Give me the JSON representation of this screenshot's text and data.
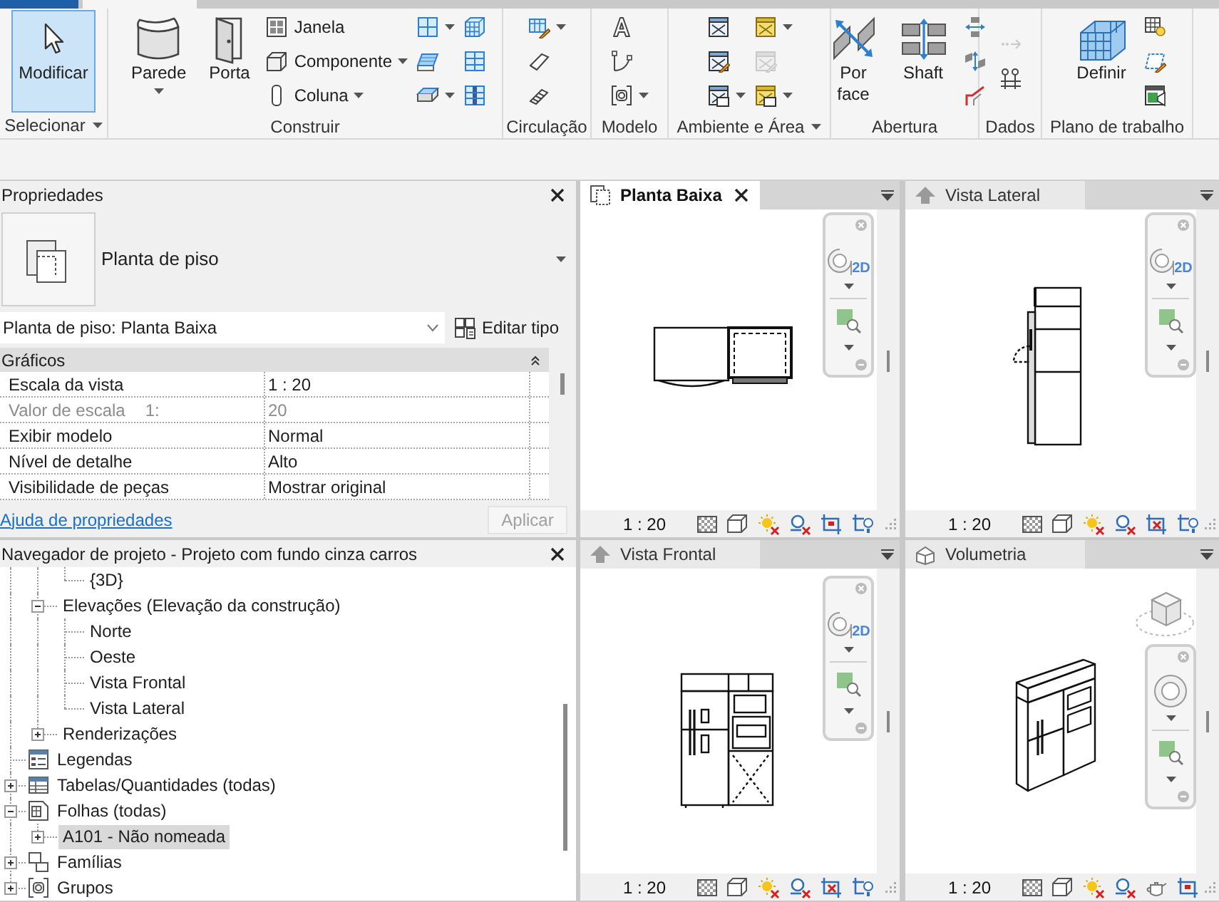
{
  "ribbon": {
    "panels": [
      {
        "title": "Selecionar",
        "menu": true,
        "tools": [
          {
            "kind": "large",
            "label": "Modificar",
            "selected": true,
            "dropdown": false,
            "disabled": false
          }
        ]
      },
      {
        "title": "Construir",
        "menu": false,
        "tools": [
          {
            "kind": "large",
            "label": "Parede",
            "selected": false,
            "dropdown": true,
            "disabled": false
          },
          {
            "kind": "large",
            "label": "Porta",
            "selected": false,
            "dropdown": false,
            "disabled": false
          },
          {
            "kind": "small",
            "label": "Janela",
            "dropdown": false,
            "disabled": false
          },
          {
            "kind": "small",
            "label": "Componente",
            "dropdown": true,
            "disabled": false
          },
          {
            "kind": "small",
            "label": "Coluna",
            "dropdown": true,
            "disabled": false
          },
          {
            "kind": "icon",
            "dropdown": true,
            "disabled": false
          },
          {
            "kind": "icon",
            "dropdown": false,
            "disabled": false
          },
          {
            "kind": "icon",
            "dropdown": true,
            "disabled": false
          },
          {
            "kind": "icon",
            "dropdown": false,
            "disabled": false
          },
          {
            "kind": "icon",
            "dropdown": false,
            "disabled": false
          },
          {
            "kind": "icon",
            "dropdown": false,
            "disabled": false
          }
        ]
      },
      {
        "title": "Circulação",
        "menu": false,
        "tools": [
          {
            "kind": "icon",
            "dropdown": true,
            "disabled": false
          },
          {
            "kind": "icon",
            "dropdown": false,
            "disabled": false
          },
          {
            "kind": "icon",
            "dropdown": false,
            "disabled": false
          }
        ]
      },
      {
        "title": "Modelo",
        "menu": false,
        "tools": [
          {
            "kind": "icon",
            "dropdown": false,
            "disabled": false
          },
          {
            "kind": "icon",
            "dropdown": false,
            "disabled": false
          },
          {
            "kind": "icon",
            "dropdown": true,
            "disabled": false
          }
        ]
      },
      {
        "title": "Ambiente e Área",
        "menu": true,
        "tools": [
          {
            "kind": "icon",
            "dropdown": false,
            "disabled": false
          },
          {
            "kind": "icon",
            "dropdown": false,
            "disabled": false
          },
          {
            "kind": "icon",
            "dropdown": true,
            "disabled": false
          },
          {
            "kind": "icon",
            "dropdown": true,
            "disabled": false
          },
          {
            "kind": "icon",
            "dropdown": false,
            "disabled": true
          },
          {
            "kind": "icon",
            "dropdown": true,
            "disabled": false
          }
        ]
      },
      {
        "title": "Abertura",
        "menu": false,
        "tools": [
          {
            "kind": "large",
            "label": "Por face",
            "selected": false,
            "dropdown": false,
            "disabled": false
          },
          {
            "kind": "large",
            "label": "Shaft",
            "selected": false,
            "dropdown": false,
            "disabled": false
          },
          {
            "kind": "icon",
            "dropdown": false,
            "disabled": false
          },
          {
            "kind": "icon",
            "dropdown": false,
            "disabled": false
          },
          {
            "kind": "icon",
            "dropdown": false,
            "disabled": false
          }
        ]
      },
      {
        "title": "Dados",
        "menu": false,
        "tools": [
          {
            "kind": "icon",
            "dropdown": false,
            "disabled": true
          },
          {
            "kind": "icon",
            "dropdown": false,
            "disabled": false
          }
        ]
      },
      {
        "title": "Plano de trabalho",
        "menu": false,
        "tools": [
          {
            "kind": "large",
            "label": "Definir",
            "selected": false,
            "dropdown": false,
            "disabled": false
          },
          {
            "kind": "icon",
            "dropdown": false,
            "disabled": false
          },
          {
            "kind": "icon",
            "dropdown": false,
            "disabled": false
          },
          {
            "kind": "icon",
            "dropdown": false,
            "disabled": false
          }
        ]
      }
    ]
  },
  "properties": {
    "title": "Propriedades",
    "type_name": "Planta de piso",
    "instance": "Planta de piso: Planta Baixa",
    "edit_type": "Editar tipo",
    "group": {
      "label": "Gráficos",
      "expanded": true,
      "rows": [
        {
          "name": "Escala da vista",
          "value": "1 : 20",
          "disabled": false
        },
        {
          "name": "Valor de escala",
          "suffix": "1:",
          "value": "20",
          "disabled": true
        },
        {
          "name": "Exibir modelo",
          "value": "Normal",
          "disabled": false
        },
        {
          "name": "Nível de detalhe",
          "value": "Alto",
          "disabled": false
        },
        {
          "name": "Visibilidade de peças",
          "value": "Mostrar original",
          "disabled": false
        }
      ]
    },
    "help_link": "Ajuda de propriedades",
    "apply": {
      "label": "Aplicar",
      "disabled": true
    }
  },
  "project_browser": {
    "title": "Navegador de projeto - Projeto com fundo cinza carros",
    "tree": [
      {
        "children": [
          {
            "children": [
              {
                "label": "{3D}",
                "selected": false
              }
            ]
          },
          {
            "label": "Elevações (Elevação da construção)",
            "expanded": true,
            "selected": false,
            "children": [
              {
                "label": "Norte",
                "selected": false
              },
              {
                "label": "Oeste",
                "selected": false
              },
              {
                "label": "Vista Frontal",
                "selected": false
              },
              {
                "label": "Vista Lateral",
                "selected": false
              }
            ]
          },
          {
            "label": "Renderizações",
            "expanded": false,
            "selected": false
          }
        ]
      },
      {
        "label": "Legendas",
        "selected": false
      },
      {
        "label": "Tabelas/Quantidades (todas)",
        "expanded": false,
        "selected": false
      },
      {
        "label": "Folhas (todas)",
        "expanded": true,
        "selected": false,
        "children": [
          {
            "label": "A101 - Não nomeada",
            "expanded": false,
            "selected": true
          }
        ]
      },
      {
        "label": "Famílias",
        "expanded": false,
        "selected": false
      },
      {
        "label": "Grupos",
        "expanded": false,
        "selected": false
      }
    ]
  },
  "views": [
    {
      "title": "Planta Baixa",
      "kind": "plan",
      "selected": true,
      "wheel_label": "2D",
      "scale": "1 : 20"
    },
    {
      "title": "Vista Lateral",
      "kind": "elevation",
      "selected": false,
      "wheel_label": "2D",
      "scale": "1 : 20"
    },
    {
      "title": "Vista Frontal",
      "kind": "elevation",
      "selected": false,
      "wheel_label": "2D",
      "scale": "1 : 20"
    },
    {
      "title": "Volumetria",
      "kind": "isometric",
      "selected": false,
      "scale": "1 : 20"
    }
  ]
}
